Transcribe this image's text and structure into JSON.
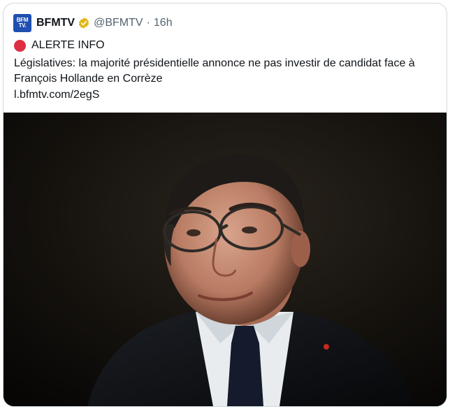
{
  "tweet": {
    "author": {
      "avatar_text_top": "BFM",
      "avatar_text_bottom": "TV.",
      "display_name": "BFMTV",
      "handle": "@BFMTV",
      "separator": "·",
      "time": "16h",
      "verified_color": "#e2b719"
    },
    "alert_label": "ALERTE INFO",
    "text": "Législatives: la majorité présidentielle annonce ne pas investir de candidat face à François Hollande en Corrèze",
    "link": "l.bfmtv.com/2egS",
    "media": {
      "type": "photo",
      "icon": "portrait-photo"
    }
  }
}
